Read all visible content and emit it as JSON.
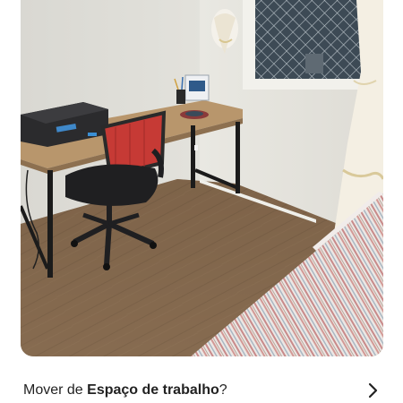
{
  "move_row": {
    "prefix": "Mover de ",
    "target": "Espaço de trabalho",
    "suffix": "?",
    "icon": "chevron-right-icon"
  },
  "photo": {
    "subject": "workspace-photo"
  },
  "colors": {
    "text": "#222222",
    "background": "#ffffff"
  }
}
